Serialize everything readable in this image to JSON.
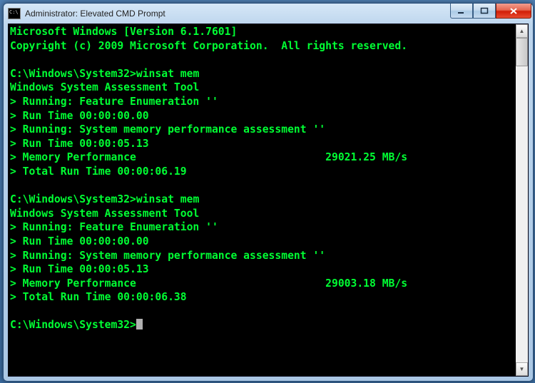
{
  "titlebar": {
    "title": "Administrator: Elevated CMD Prompt",
    "icon_name": "cmd-icon"
  },
  "terminal": {
    "header_line1": "Microsoft Windows [Version 6.1.7601]",
    "header_line2": "Copyright (c) 2009 Microsoft Corporation.  All rights reserved.",
    "blocks": [
      {
        "prompt": "C:\\Windows\\System32>",
        "command": "winsat mem",
        "tool_line": "Windows System Assessment Tool",
        "lines": [
          "> Running: Feature Enumeration ''",
          "> Run Time 00:00:00.00",
          "> Running: System memory performance assessment ''",
          "> Run Time 00:00:05.13",
          "> Memory Performance                              29021.25 MB/s",
          "> Total Run Time 00:00:06.19"
        ]
      },
      {
        "prompt": "C:\\Windows\\System32>",
        "command": "winsat mem",
        "tool_line": "Windows System Assessment Tool",
        "lines": [
          "> Running: Feature Enumeration ''",
          "> Run Time 00:00:00.00",
          "> Running: System memory performance assessment ''",
          "> Run Time 00:00:05.13",
          "> Memory Performance                              29003.18 MB/s",
          "> Total Run Time 00:00:06.38"
        ]
      }
    ],
    "final_prompt": "C:\\Windows\\System32>"
  }
}
